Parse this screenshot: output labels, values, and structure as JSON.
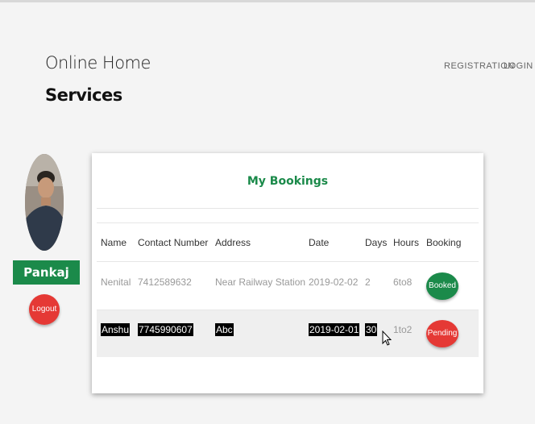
{
  "header": {
    "brand_line1": "Online Home",
    "brand_line2": "Services",
    "nav": [
      "REGISTRATION",
      "LOGIN"
    ]
  },
  "sidebar": {
    "username": "Pankaj",
    "logout_label": "Logout"
  },
  "bookings": {
    "title": "My Bookings",
    "columns": [
      "Name",
      "Contact Number",
      "Address",
      "Date",
      "Days",
      "Hours",
      "Booking"
    ],
    "rows": [
      {
        "name": "Nenital",
        "contact": "7412589632",
        "address": "Near Railway Station",
        "date": "2019-02-02",
        "days": "2",
        "hours": "6to8",
        "status": "Booked"
      },
      {
        "name": "Anshu",
        "contact": "7745990607",
        "address": "Abc",
        "date": "2019-02-01",
        "days": "30",
        "hours": "1to2",
        "status": "Pending"
      }
    ]
  },
  "colors": {
    "brand_green": "#1b8a4a",
    "danger_red": "#e53935",
    "selection": "#000000"
  },
  "icons": [
    "avatar-photo",
    "mouse-cursor-icon"
  ]
}
